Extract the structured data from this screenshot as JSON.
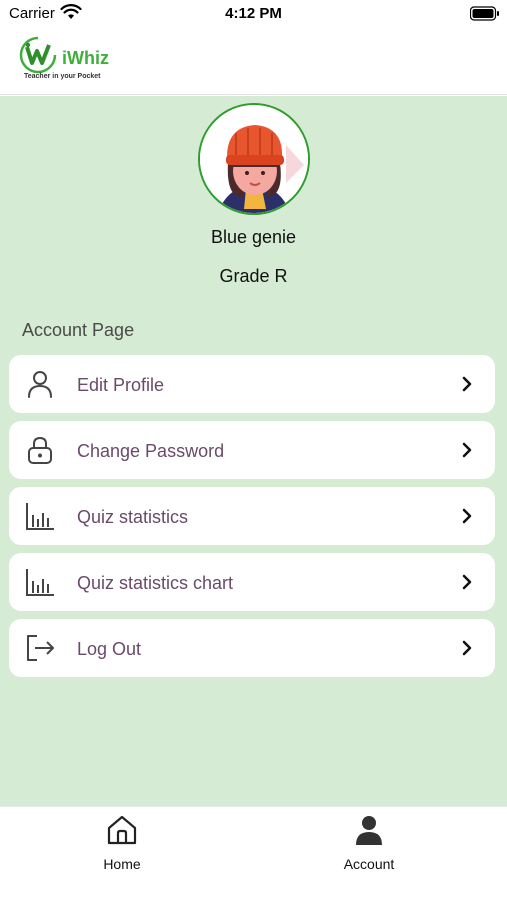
{
  "status_bar": {
    "carrier": "Carrier",
    "time": "4:12 PM"
  },
  "header": {
    "logo_name": "iWhiz",
    "logo_tagline": "Teacher in your Pocket"
  },
  "profile": {
    "name": "Blue  genie",
    "grade": "Grade R"
  },
  "section_title": "Account Page",
  "menu": [
    {
      "label": "Edit Profile",
      "icon": "person-icon"
    },
    {
      "label": "Change Password",
      "icon": "lock-icon"
    },
    {
      "label": "Quiz statistics",
      "icon": "bar-chart-icon"
    },
    {
      "label": "Quiz statistics chart",
      "icon": "bar-chart-icon"
    },
    {
      "label": "Log Out",
      "icon": "logout-icon"
    }
  ],
  "tabs": [
    {
      "label": "Home",
      "icon": "home-icon"
    },
    {
      "label": "Account",
      "icon": "account-icon"
    }
  ],
  "colors": {
    "background": "#d5ebd3",
    "brand_green": "#3fae3a",
    "menu_text": "#6a4a6a"
  }
}
